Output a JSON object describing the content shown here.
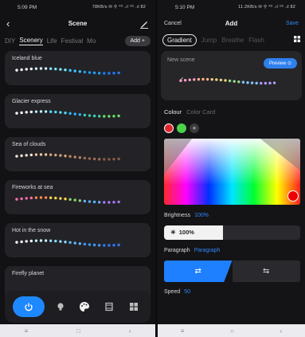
{
  "left": {
    "status": {
      "time": "5:09 PM",
      "right": "78KB/s ✉ ⚲ ⁴ᴳ .ıl ⁵ᴳ .ıl 82"
    },
    "header": {
      "title": "Scene"
    },
    "tabs": [
      "DIY",
      "Scenery",
      "Life",
      "Festival",
      "Mo"
    ],
    "active_tab": "Scenery",
    "add_label": "Add +",
    "cards": [
      {
        "name": "Iceland blue",
        "colors": [
          "#ffffff",
          "#d4f2ff",
          "#7fe3ff",
          "#39c6ff",
          "#1aa0ff",
          "#1f7bff"
        ]
      },
      {
        "name": "Glacier express",
        "colors": [
          "#ffffff",
          "#b8f0ff",
          "#57d7ff",
          "#2bb5ff",
          "#3dd1b0",
          "#6ae36a"
        ]
      },
      {
        "name": "Sea of clouds",
        "colors": [
          "#f5e9d8",
          "#e9c9a0",
          "#d4a27a",
          "#b98566",
          "#a06a55",
          "#8a5a4a"
        ]
      },
      {
        "name": "Fireworks at sea",
        "colors": [
          "#ff6fb0",
          "#ff8a4d",
          "#ffd44d",
          "#8fd16f",
          "#5cb3ff",
          "#a77bff"
        ]
      },
      {
        "name": "Hot in the snow",
        "colors": [
          "#ffffff",
          "#c9f0ff",
          "#8fd8ff",
          "#60b9ff",
          "#3e98ff",
          "#2d7bff"
        ]
      },
      {
        "name": "Firefly planet",
        "colors": []
      }
    ],
    "nav": [
      "power-icon",
      "bulb-icon",
      "palette-icon",
      "film-icon",
      "grid-icon"
    ],
    "sys": [
      "≡",
      "□",
      "‹"
    ]
  },
  "right": {
    "status": {
      "time": "5:10 PM",
      "right": "11.2KB/s ✉ ⚲ ⁴ᴳ .ıl ⁵ᴳ .ıl 82"
    },
    "header": {
      "cancel": "Cancel",
      "title": "Add",
      "save": "Save"
    },
    "modes": [
      "Gradient",
      "Jump",
      "Breathe",
      "Flash"
    ],
    "active_mode": "Gradient",
    "scene_name": "New scene",
    "preview_label": "Preview ⊙",
    "preview_colors": [
      "#ff9cc6",
      "#ffb08a",
      "#f3d27f",
      "#9bd88b",
      "#7fc8ff",
      "#b39bff"
    ],
    "colour_tab": "Colour",
    "color_card_tab": "Color Card",
    "swatches": [
      "#e0252b",
      "#4cd24c"
    ],
    "brightness_label": "Brightness",
    "brightness_value": "100%",
    "brightness_fill": 0.43,
    "slider_text": "100%",
    "paragraph_label": "Paragraph",
    "paragraph_value": "Paragraph",
    "dir_on": "⇄",
    "dir_off": "⇆",
    "speed_label": "Speed",
    "speed_value": "50",
    "sys": [
      "≡",
      "○",
      "‹"
    ]
  }
}
